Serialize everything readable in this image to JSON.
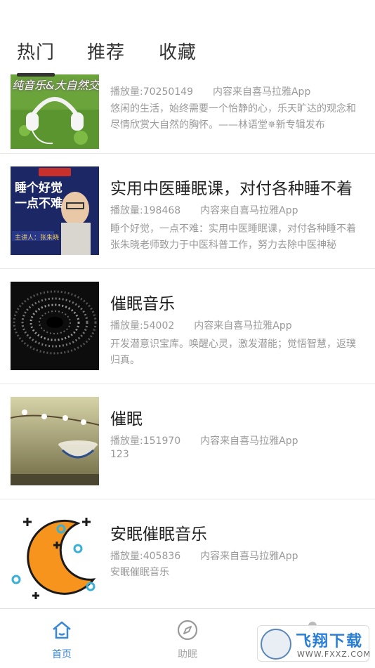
{
  "tabs": [
    {
      "label": "热门",
      "active": true
    },
    {
      "label": "推荐"
    },
    {
      "label": "收藏"
    }
  ],
  "items": [
    {
      "title": "",
      "plays": "播放量:70250149",
      "source": "内容来自喜马拉雅App",
      "desc": "悠闲的生活，始终需要一个怡静的心，乐天旷达的观念和尽情欣赏大自然的胸怀。——林语堂✵新专辑发布",
      "thumb_text": "纯音乐&大自然交织",
      "thumb_icon": "headphones-on-grass"
    },
    {
      "title": "实用中医睡眠课，对付各种睡不着",
      "plays": "播放量:198468",
      "source": "内容来自喜马拉雅App",
      "desc": "睡个好觉，一点不难：实用中医睡眠课，对付各种睡不着张朱晓老师致力于中医科普工作，努力去除中医神秘",
      "thumb_text": "睡个好觉 一点不难",
      "thumb_sub": "主讲人：张朱晓",
      "thumb_icon": "lecturer-portrait"
    },
    {
      "title": "催眠音乐",
      "plays": "播放量:54002",
      "source": "内容来自喜马拉雅App",
      "desc": "开发潜意识宝库。唤醒心灵，激发潜能；觉悟智慧，返璞归真。",
      "thumb_icon": "hypnotic-spiral"
    },
    {
      "title": "催眠",
      "plays": "播放量:151970",
      "source": "内容来自喜马拉雅App",
      "desc": "123",
      "thumb_icon": "tea-cup-blossom"
    },
    {
      "title": "安眠催眠音乐",
      "plays": "播放量:405836",
      "source": "内容来自喜马拉雅App",
      "desc": "安眠催眠音乐",
      "thumb_icon": "crescent-moon-stars"
    }
  ],
  "bottom_nav": [
    {
      "label": "首页",
      "icon": "home-icon",
      "active": true
    },
    {
      "label": "助眠",
      "icon": "compass-icon"
    },
    {
      "label": "",
      "icon": "user-icon"
    }
  ],
  "watermark": {
    "text": "飞翔下载",
    "url": "WWW.FXXZ.COM"
  },
  "colors": {
    "accent": "#3a87d6",
    "divider": "#e8e8e8",
    "meta": "#999999"
  }
}
